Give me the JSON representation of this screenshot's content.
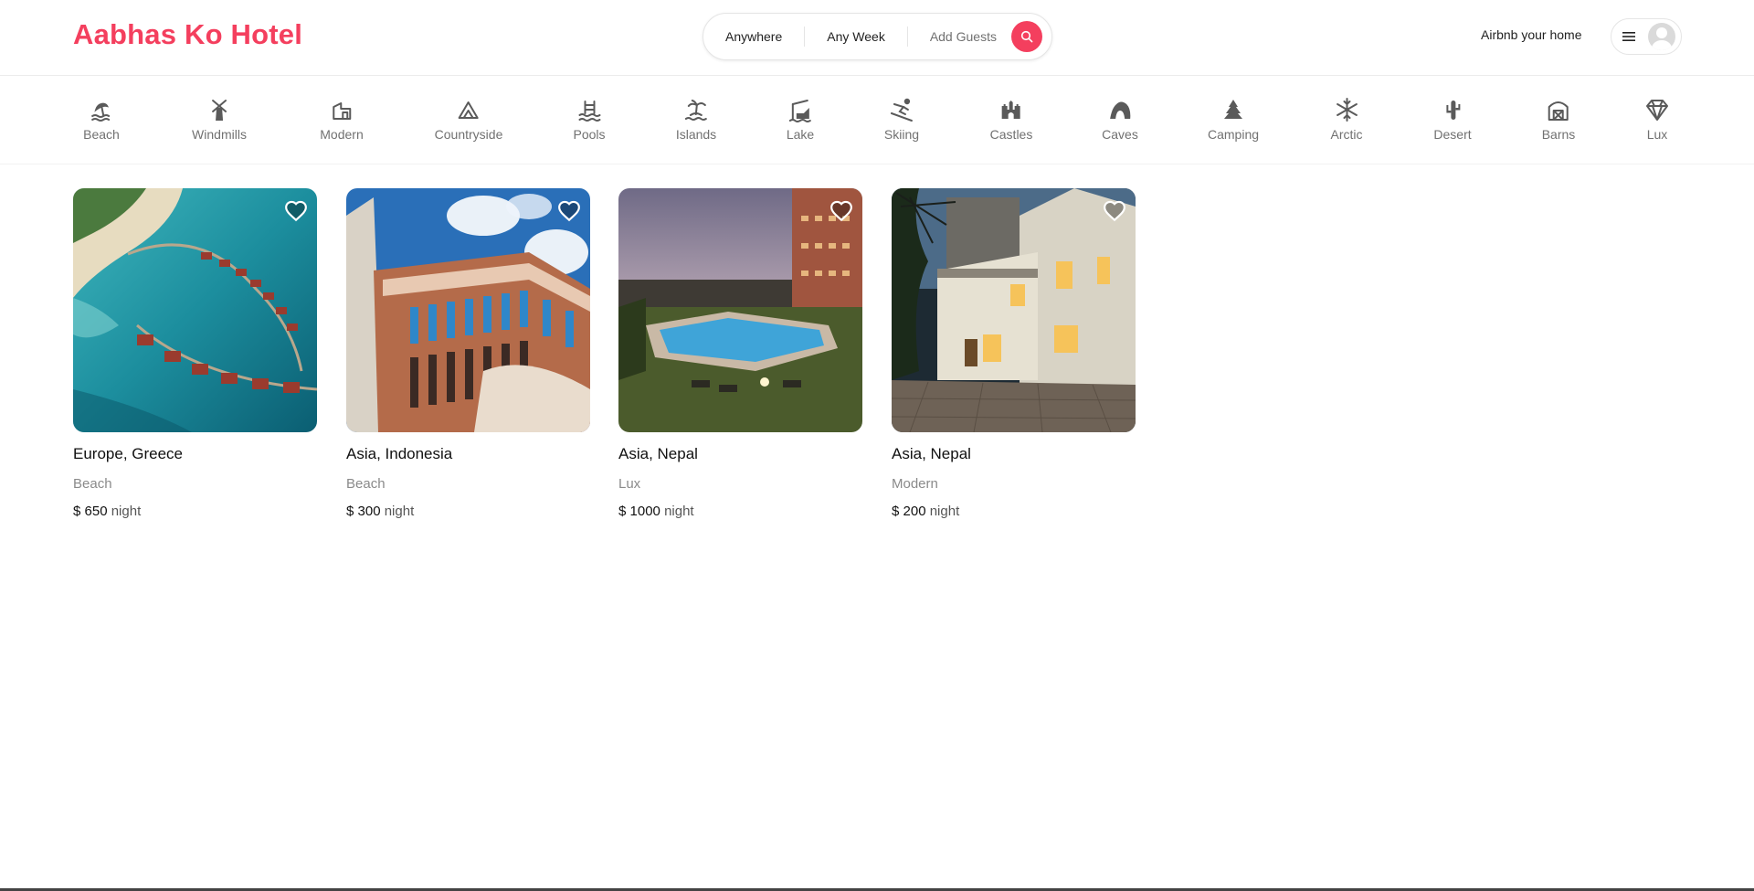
{
  "header": {
    "logo": "Aabhas Ko Hotel",
    "search": {
      "where": "Anywhere",
      "when": "Any Week",
      "guests": "Add Guests"
    },
    "host_link": "Airbnb your home"
  },
  "categories": [
    {
      "label": "Beach",
      "icon": "beach-icon"
    },
    {
      "label": "Windmills",
      "icon": "windmill-icon"
    },
    {
      "label": "Modern",
      "icon": "modern-icon"
    },
    {
      "label": "Countryside",
      "icon": "mountain-icon"
    },
    {
      "label": "Pools",
      "icon": "pool-icon"
    },
    {
      "label": "Islands",
      "icon": "island-icon"
    },
    {
      "label": "Lake",
      "icon": "lake-icon"
    },
    {
      "label": "Skiing",
      "icon": "skiing-icon"
    },
    {
      "label": "Castles",
      "icon": "castle-icon"
    },
    {
      "label": "Caves",
      "icon": "cave-icon"
    },
    {
      "label": "Camping",
      "icon": "tree-icon"
    },
    {
      "label": "Arctic",
      "icon": "snowflake-icon"
    },
    {
      "label": "Desert",
      "icon": "cactus-icon"
    },
    {
      "label": "Barns",
      "icon": "barn-icon"
    },
    {
      "label": "Lux",
      "icon": "diamond-icon"
    }
  ],
  "listings": [
    {
      "location": "Europe, Greece",
      "category": "Beach",
      "price": "$ 650",
      "unit": "night"
    },
    {
      "location": "Asia, Indonesia",
      "category": "Beach",
      "price": "$ 300",
      "unit": "night"
    },
    {
      "location": "Asia, Nepal",
      "category": "Lux",
      "price": "$ 1000",
      "unit": "night"
    },
    {
      "location": "Asia, Nepal",
      "category": "Modern",
      "price": "$ 200",
      "unit": "night"
    }
  ],
  "colors": {
    "brand": "#f43f5e",
    "muted_text": "#717171",
    "icon": "#5a5a5a"
  }
}
